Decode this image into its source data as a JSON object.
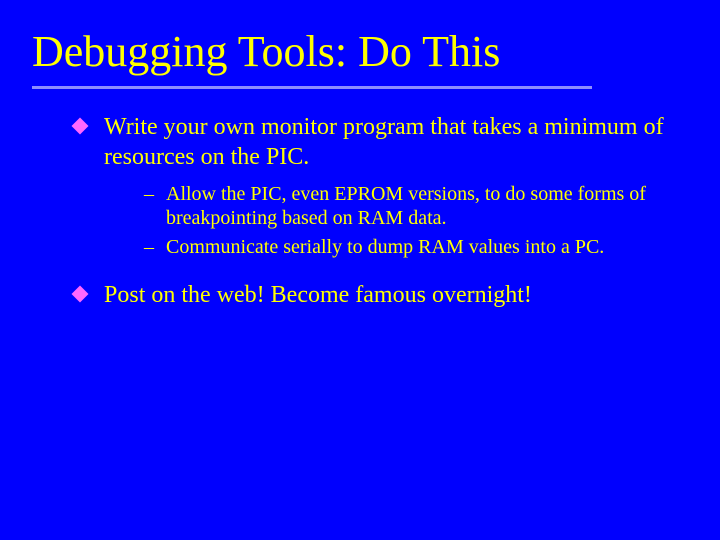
{
  "title": "Debugging Tools: Do This",
  "bullets": [
    {
      "text": "Write your own monitor program that takes a minimum of resources on the PIC.",
      "sub": [
        "Allow the PIC, even EPROM versions, to do some forms of breakpointing based on RAM data.",
        "Communicate serially to dump RAM values into a PC."
      ]
    },
    {
      "text": "Post on the web! Become famous overnight!",
      "sub": []
    }
  ],
  "dash": "–"
}
